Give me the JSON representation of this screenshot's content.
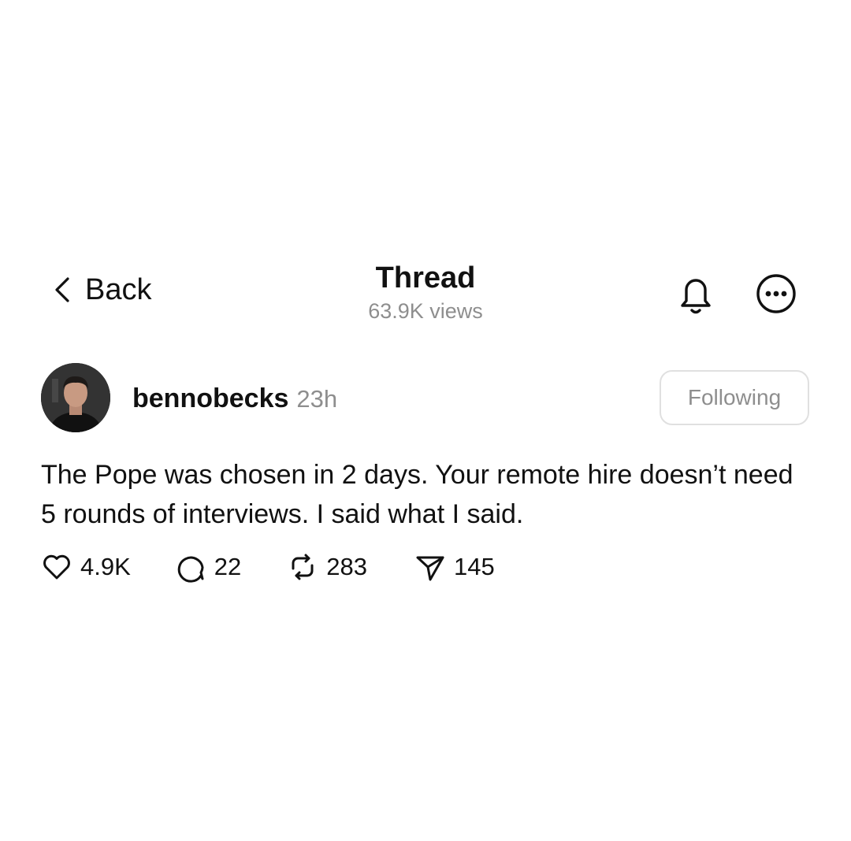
{
  "header": {
    "back_label": "Back",
    "title": "Thread",
    "views": "63.9K views",
    "icons": [
      "chevron-left-icon",
      "bell-icon",
      "more-icon"
    ]
  },
  "post": {
    "username": "bennobecks",
    "time": "23h",
    "follow_label": "Following",
    "text": "The Pope was chosen in 2 days. Your remote hire doesn’t need 5 rounds of interviews. I said what I said.",
    "actions": {
      "likes": "4.9K",
      "replies": "22",
      "reposts": "283",
      "shares": "145"
    }
  },
  "colors": {
    "text": "#111111",
    "muted": "#8e8e8e",
    "border": "#e0e0e0",
    "background": "#ffffff"
  }
}
